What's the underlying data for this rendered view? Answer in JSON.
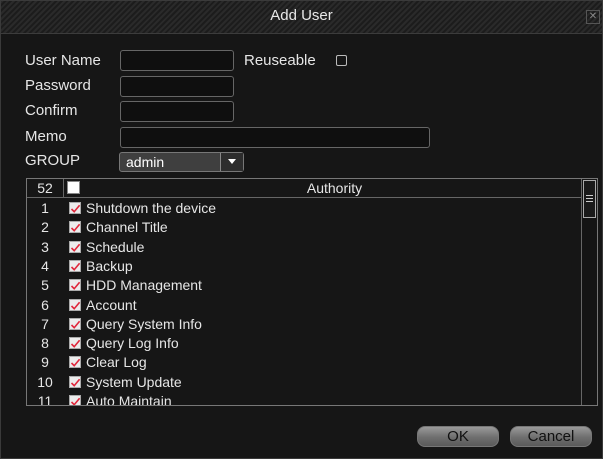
{
  "window": {
    "title": "Add User",
    "close_glyph": "✕"
  },
  "form": {
    "user_name_label": "User Name",
    "user_name_value": "",
    "reuseable_label": "Reuseable",
    "reuseable_checked": false,
    "password_label": "Password",
    "password_value": "",
    "confirm_label": "Confirm",
    "confirm_value": "",
    "memo_label": "Memo",
    "memo_value": "",
    "group_label": "GROUP",
    "group_selected": "admin"
  },
  "authority_list": {
    "count": "52",
    "header_label": "Authority",
    "header_checked": false,
    "items": [
      {
        "num": "1",
        "label": "Shutdown the device",
        "checked": true
      },
      {
        "num": "2",
        "label": "Channel Title",
        "checked": true
      },
      {
        "num": "3",
        "label": "Schedule",
        "checked": true
      },
      {
        "num": "4",
        "label": "Backup",
        "checked": true
      },
      {
        "num": "5",
        "label": "HDD Management",
        "checked": true
      },
      {
        "num": "6",
        "label": "Account",
        "checked": true
      },
      {
        "num": "7",
        "label": "Query System Info",
        "checked": true
      },
      {
        "num": "8",
        "label": "Query Log Info",
        "checked": true
      },
      {
        "num": "9",
        "label": "Clear Log",
        "checked": true
      },
      {
        "num": "10",
        "label": "System Update",
        "checked": true
      },
      {
        "num": "11",
        "label": "Auto Maintain",
        "checked": true
      }
    ]
  },
  "buttons": {
    "ok_label": "OK",
    "cancel_label": "Cancel"
  },
  "colors": {
    "check_mark": "#e0263a",
    "background": "#161616",
    "button": "#8a8a8a"
  }
}
